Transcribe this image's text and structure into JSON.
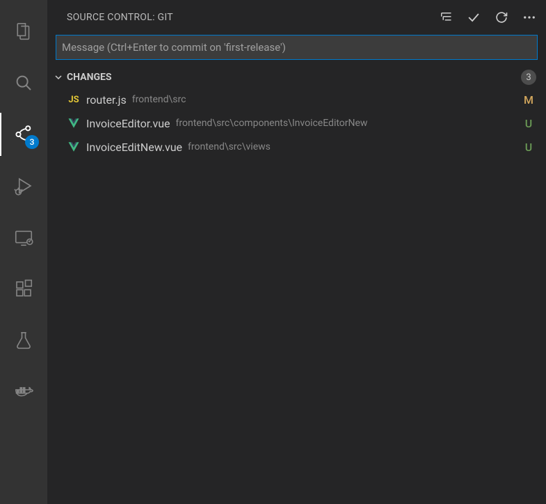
{
  "activity": {
    "scm_badge": "3"
  },
  "header": {
    "title": "SOURCE CONTROL: GIT"
  },
  "commit": {
    "placeholder": "Message (Ctrl+Enter to commit on 'first-release')"
  },
  "section": {
    "label": "CHANGES",
    "count": "3"
  },
  "files": [
    {
      "icon": "js",
      "name": "router.js",
      "path": "frontend\\src",
      "status": "M"
    },
    {
      "icon": "vue",
      "name": "InvoiceEditor.vue",
      "path": "frontend\\src\\components\\InvoiceEditorNew",
      "status": "U"
    },
    {
      "icon": "vue",
      "name": "InvoiceEditNew.vue",
      "path": "frontend\\src\\views",
      "status": "U"
    }
  ]
}
